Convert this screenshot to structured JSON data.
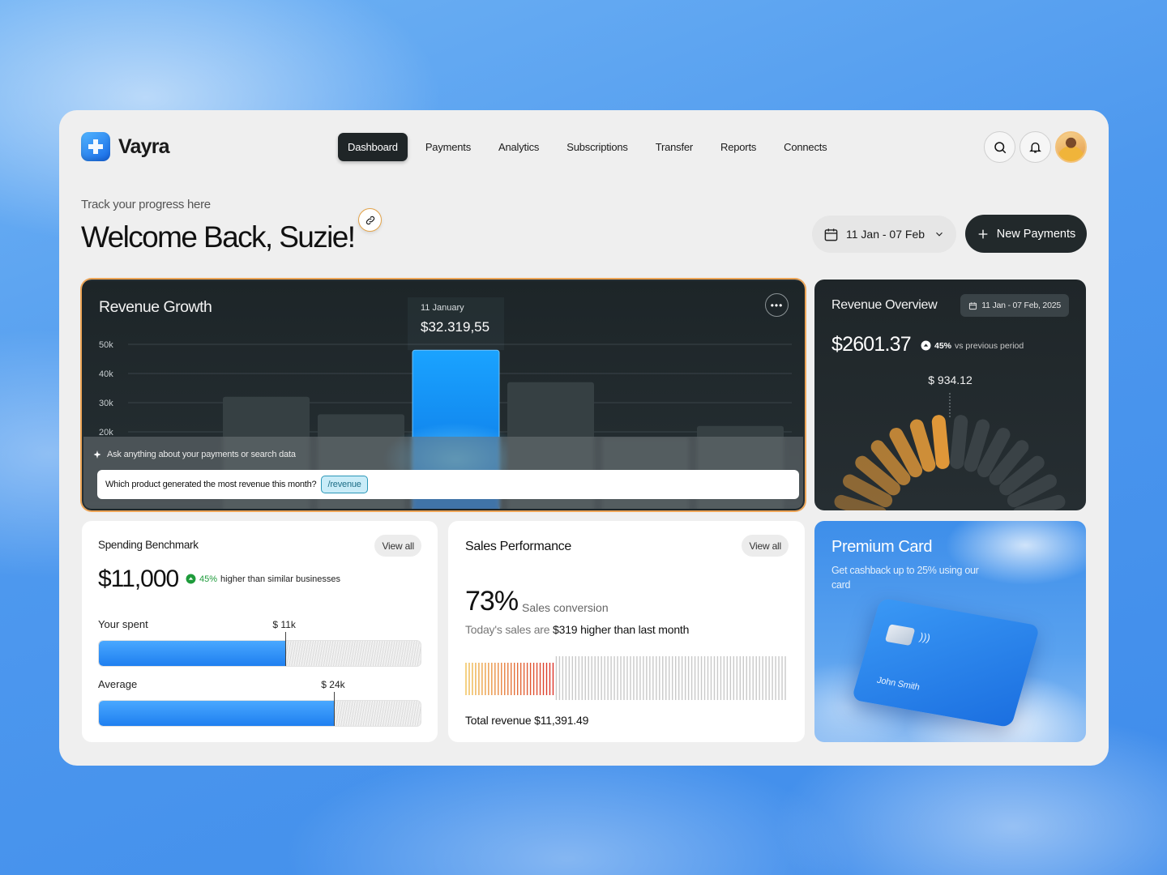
{
  "app": {
    "name": "Vayra"
  },
  "nav": {
    "items": [
      "Dashboard",
      "Payments",
      "Analytics",
      "Subscriptions",
      "Transfer",
      "Reports",
      "Connects"
    ],
    "active": "Dashboard"
  },
  "header": {
    "subtitle": "Track your progress here",
    "welcome": "Welcome Back, Suzie!",
    "date_range": "11 Jan - 07 Feb",
    "new_payments_label": "New Payments"
  },
  "revenue_growth": {
    "title": "Revenue Growth",
    "tooltip_date": "11 January",
    "tooltip_value": "$32.319,55",
    "ask_label": "Ask anything about your payments or search data",
    "ask_input_value": "Which product generated the most revenue this month?",
    "ask_tag": "/revenue"
  },
  "chart_data": {
    "type": "bar",
    "title": "Revenue Growth",
    "y_ticks": [
      "50k",
      "40k",
      "30k",
      "20k"
    ],
    "ylim": [
      15000,
      55000
    ],
    "values": [
      null,
      32000,
      26000,
      48000,
      37000,
      18000,
      22000
    ],
    "highlighted_index": 3,
    "highlighted_label": "11 January",
    "grid": true
  },
  "revenue_overview": {
    "title": "Revenue Overview",
    "range": "11 Jan - 07 Feb, 2025",
    "amount": "$2601.37",
    "delta_pct": "45%",
    "delta_text": "vs previous period",
    "gauge_value": "$ 934.12",
    "gauge_fraction": 0.33,
    "colors": {
      "active": "#f0a13a",
      "inactive": "#3a4246"
    }
  },
  "spending": {
    "title": "Spending Benchmark",
    "view_all": "View all",
    "amount": "$11,000",
    "delta_pct": "45%",
    "delta_text": "higher than similar businesses",
    "your_spent_label": "Your spent",
    "your_spent_value": "$ 11k",
    "your_spent_fraction": 0.58,
    "average_label": "Average",
    "average_value": "$ 24k",
    "average_fraction": 0.73
  },
  "sales": {
    "title": "Sales Performance",
    "view_all": "View all",
    "conversion_pct": "73%",
    "conversion_label": "Sales conversion",
    "compare_prefix": "Today's sales are",
    "compare_highlight": "$319 higher than last month",
    "total_revenue": "Total revenue $11,391.49",
    "filled_fraction": 0.28
  },
  "premium": {
    "title": "Premium Card",
    "description": "Get cashback up to 25% using our card",
    "card_holder": "John Smith"
  },
  "icons": [
    "logo-mark-icon",
    "search-icon",
    "bell-icon",
    "link-icon",
    "calendar-icon",
    "chevron-down-icon",
    "plus-icon",
    "more-icon",
    "sparkle-icon",
    "arrow-up-icon",
    "chip-icon",
    "contactless-icon"
  ]
}
